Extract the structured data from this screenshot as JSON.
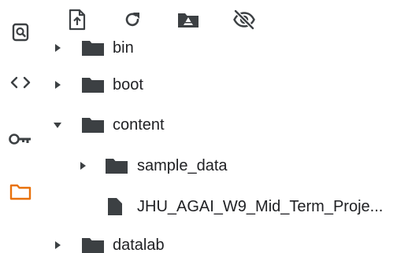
{
  "colors": {
    "icon": "#3c4043",
    "folder": "#3c4043",
    "active_accent": "#e8710a",
    "text": "#202124"
  },
  "sidebar": {
    "items": [
      {
        "icon": "search-icon"
      },
      {
        "icon": "code-icon"
      },
      {
        "icon": "key-icon"
      },
      {
        "icon": "folder-icon",
        "active": true
      }
    ]
  },
  "toolbar": {
    "buttons": [
      {
        "icon": "upload-file-icon"
      },
      {
        "icon": "refresh-icon"
      },
      {
        "icon": "google-drive-icon"
      },
      {
        "icon": "eye-off-icon"
      }
    ]
  },
  "tree": {
    "items": [
      {
        "label": "bin",
        "type": "folder",
        "expanded": false
      },
      {
        "label": "boot",
        "type": "folder",
        "expanded": false
      },
      {
        "label": "content",
        "type": "folder",
        "expanded": true
      },
      {
        "label": "sample_data",
        "type": "folder",
        "expanded": false
      },
      {
        "label": "JHU_AGAI_W9_Mid_Term_Proje...",
        "type": "file"
      },
      {
        "label": "datalab",
        "type": "folder",
        "expanded": false
      }
    ]
  }
}
